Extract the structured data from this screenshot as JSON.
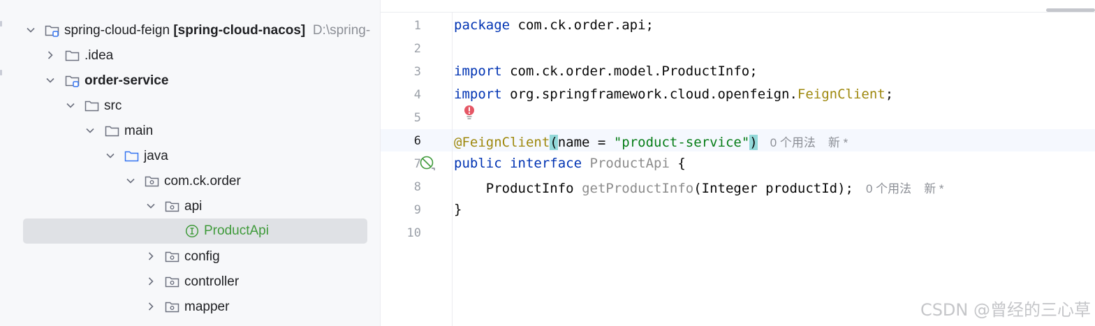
{
  "tree": {
    "items": [
      {
        "name": "spring-cloud-feign",
        "module": "[spring-cloud-nacos]",
        "path": "D:\\spring-"
      },
      {
        "name": ".idea"
      },
      {
        "name": "order-service"
      },
      {
        "name": "src"
      },
      {
        "name": "main"
      },
      {
        "name": "java"
      },
      {
        "name": "com.ck.order"
      },
      {
        "name": "api"
      },
      {
        "name": "ProductApi"
      },
      {
        "name": "config"
      },
      {
        "name": "controller"
      },
      {
        "name": "mapper"
      }
    ]
  },
  "editor": {
    "line_numbers": [
      "1",
      "2",
      "3",
      "4",
      "5",
      "6",
      "7",
      "8",
      "9",
      "10"
    ],
    "lines": {
      "l1": {
        "kw": "package",
        "rest": " com.ck.order.api;"
      },
      "l3": {
        "kw": "import",
        "rest": " com.ck.order.model.ProductInfo;"
      },
      "l4": {
        "kw": "import",
        "rest": " org.springframework.cloud.openfeign.",
        "cls": "FeignClient",
        "end": ";"
      },
      "l6": {
        "ann": "@FeignClient",
        "open": "(",
        "name": "name = ",
        "str": "\"product-service\"",
        "close": ")"
      },
      "l7": {
        "kw1": "public",
        "kw2": "interface",
        "cls": "ProductApi",
        "end": " {"
      },
      "l8": {
        "type": "ProductInfo",
        "method": "getProductInfo",
        "params": "(Integer productId);"
      },
      "l9": {
        "text": "}"
      }
    },
    "hints": {
      "usages": "0 个用法",
      "new": "新 *"
    }
  },
  "watermark": "CSDN @曾经的三心草"
}
